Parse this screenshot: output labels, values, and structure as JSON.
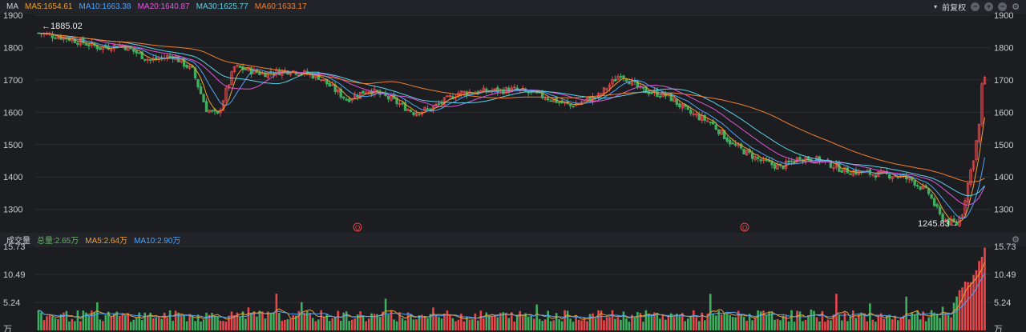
{
  "main_header": {
    "title": "MA",
    "ma": [
      {
        "label": "MA5:1654.61",
        "color": "#f0a030"
      },
      {
        "label": "MA10:1663.38",
        "color": "#4fa3f7"
      },
      {
        "label": "MA20:1640.87",
        "color": "#e056d8"
      },
      {
        "label": "MA30:1625.77",
        "color": "#5ad1e6"
      },
      {
        "label": "MA60:1633.17",
        "color": "#f07f2e"
      }
    ],
    "adjust_label": "前复权",
    "adjust_icon": "chevron-down-icon"
  },
  "volume_header": {
    "title": "成交量",
    "items": [
      {
        "label": "总量:2.65万",
        "color": "#5fb55f"
      },
      {
        "label": "MA5:2.64万",
        "color": "#f0a030"
      },
      {
        "label": "MA10:2.90万",
        "color": "#4fa3f7"
      }
    ]
  },
  "colors": {
    "up": "#e5474b",
    "down": "#3fae5f",
    "background": "#1c1d21",
    "grid": "#2c2e34"
  },
  "chart_data": [
    {
      "type": "candlestick",
      "y_ticks": [
        "1900",
        "1800",
        "1700",
        "1600",
        "1500",
        "1400",
        "1300"
      ],
      "ylim": [
        1230,
        1905
      ],
      "annotations": {
        "high": "←1885.02",
        "low": "1245.83→"
      },
      "markers": [
        "Q",
        "Q"
      ],
      "x_count": 240,
      "trend": [
        [
          0,
          1845
        ],
        [
          10,
          1830
        ],
        [
          22,
          1800
        ],
        [
          30,
          1808
        ],
        [
          40,
          1760
        ],
        [
          48,
          1775
        ],
        [
          55,
          1730
        ],
        [
          60,
          1610
        ],
        [
          64,
          1590
        ],
        [
          70,
          1740
        ],
        [
          80,
          1720
        ],
        [
          90,
          1730
        ],
        [
          100,
          1710
        ],
        [
          110,
          1640
        ],
        [
          118,
          1670
        ],
        [
          126,
          1640
        ],
        [
          134,
          1600
        ],
        [
          140,
          1610
        ],
        [
          150,
          1660
        ],
        [
          160,
          1665
        ],
        [
          170,
          1670
        ],
        [
          180,
          1650
        ],
        [
          190,
          1620
        ],
        [
          200,
          1650
        ],
        [
          208,
          1720
        ],
        [
          215,
          1670
        ],
        [
          225,
          1650
        ],
        [
          232,
          1600
        ],
        [
          240,
          1570
        ],
        [
          248,
          1500
        ],
        [
          258,
          1450
        ],
        [
          265,
          1430
        ],
        [
          272,
          1460
        ],
        [
          280,
          1450
        ],
        [
          288,
          1420
        ],
        [
          298,
          1410
        ],
        [
          306,
          1405
        ],
        [
          312,
          1390
        ],
        [
          318,
          1350
        ],
        [
          322,
          1280
        ],
        [
          325,
          1260
        ],
        [
          328,
          1255
        ],
        [
          330,
          1290
        ],
        [
          332,
          1380
        ],
        [
          334,
          1460
        ],
        [
          336,
          1560
        ],
        [
          337,
          1680
        ],
        [
          338,
          1710
        ]
      ]
    },
    {
      "type": "bar",
      "y_ticks": [
        "15.73",
        "10.49",
        "5.24",
        "万"
      ],
      "ylim": [
        0,
        15.73
      ],
      "unit": "万"
    }
  ]
}
